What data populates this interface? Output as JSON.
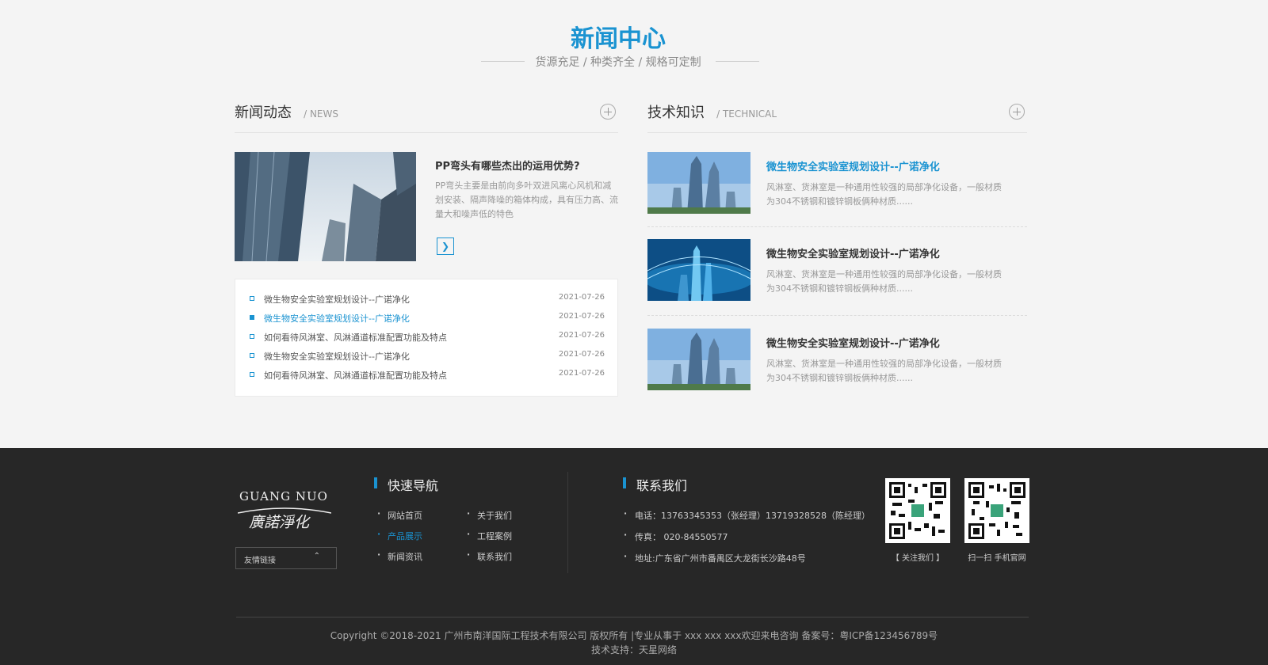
{
  "section": {
    "title": "新闻中心",
    "subtitle": "货源充足 / 种类齐全 / 规格可定制"
  },
  "news": {
    "title": "新闻动态",
    "title_en": "/ NEWS",
    "featured": {
      "title": "PP弯头有哪些杰出的运用优势?",
      "desc": "PP弯头主要是由前向多叶双进风离心风机和减划安装、隔声降噪的箱体构成，具有压力高、流量大和噪声低的特色"
    },
    "items": [
      {
        "title": "微生物安全实验室规划设计--广诺净化",
        "date": "2021-07-26"
      },
      {
        "title": "微生物安全实验室规划设计--广诺净化",
        "date": "2021-07-26"
      },
      {
        "title": "如何看待风淋室、风淋通道标准配置功能及特点",
        "date": "2021-07-26"
      },
      {
        "title": "微生物安全实验室规划设计--广诺净化",
        "date": "2021-07-26"
      },
      {
        "title": "如何看待风淋室、风淋通道标准配置功能及特点",
        "date": "2021-07-26"
      }
    ]
  },
  "tech": {
    "title": "技术知识",
    "title_en": "/ TECHNICAL",
    "items": [
      {
        "title": "微生物安全实验室规划设计--广诺净化",
        "desc": "风淋室、货淋室是一种通用性较强的局部净化设备，一般材质为304不锈钢和镀锌钢板俩种材质......"
      },
      {
        "title": "微生物安全实验室规划设计--广诺净化",
        "desc": "风淋室、货淋室是一种通用性较强的局部净化设备，一般材质为304不锈钢和镀锌钢板俩种材质......"
      },
      {
        "title": "微生物安全实验室规划设计--广诺净化",
        "desc": "风淋室、货淋室是一种通用性较强的局部净化设备，一般材质为304不锈钢和镀锌钢板俩种材质......"
      }
    ]
  },
  "footer": {
    "logo_text_top": "GUANG NUO",
    "logo_text_bottom": "廣諾淨化",
    "friend_links": "友情链接",
    "nav_title": "快速导航",
    "nav": [
      "网站首页",
      "关于我们",
      "产品展示",
      "工程案例",
      "新闻资讯",
      "联系我们"
    ],
    "contact_title": "联系我们",
    "phone": "电话：13763345353（张经理）13719328528（陈经理）",
    "fax": "传真：  020-84550577",
    "address": "地址:广东省广州市番禺区大龙街长沙路48号",
    "qr1_caption": "【 关注我们 】",
    "qr2_caption": "扫一扫 手机官网",
    "copyright": "Copyright ©2018-2021 广州市南洋国际工程技术有限公司 版权所有 |专业从事于 xxx xxx xxx欢迎来电咨询 备案号：粤ICP备123456789号",
    "support": "技术支持：天星网络"
  },
  "colors": {
    "accent": "#1a93d1",
    "footer_bg": "#272727",
    "page_bg": "#f4f4f4"
  }
}
